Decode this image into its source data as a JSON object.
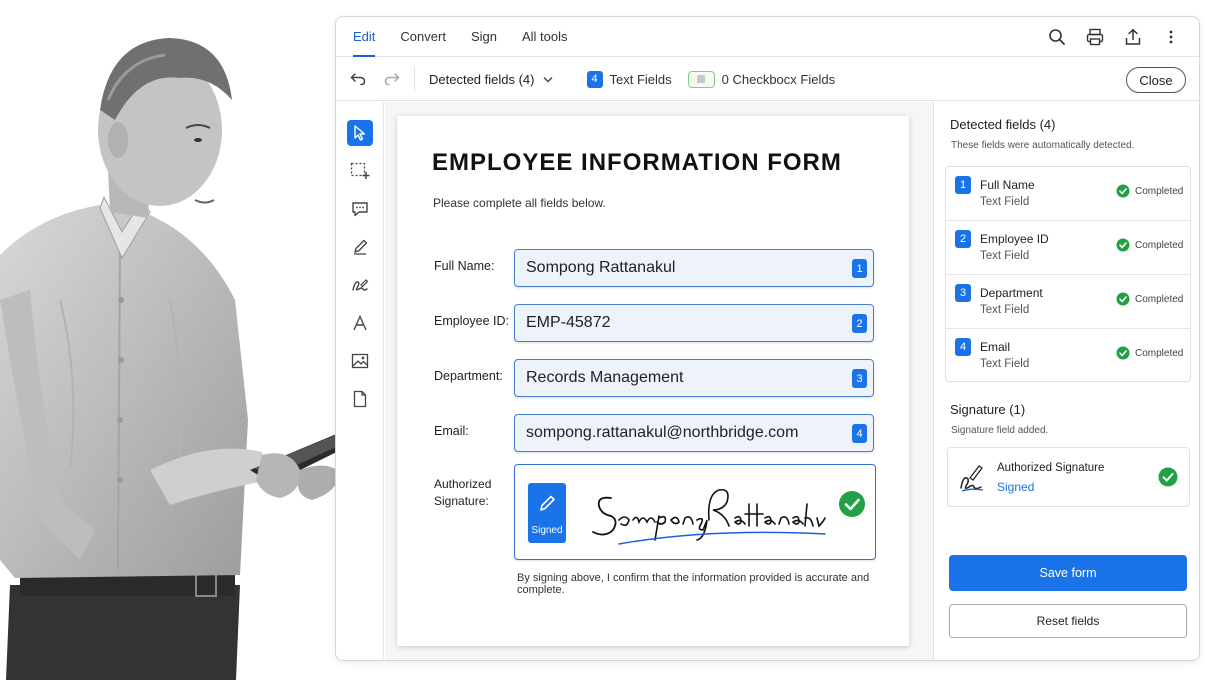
{
  "menubar": {
    "tabs": [
      {
        "label": "Edit",
        "active": true
      },
      {
        "label": "Convert"
      },
      {
        "label": "Sign"
      },
      {
        "label": "All tools"
      }
    ],
    "tools": [
      "search-icon",
      "print-icon",
      "share-icon",
      "more-icon"
    ]
  },
  "toolbar": {
    "detected_label": "Detected fields (4)",
    "text_fields_count": "4",
    "text_fields_label": "Text Fields",
    "checkbox_label": "0  Checkbocx Fields",
    "close_label": "Close"
  },
  "left_tools": [
    "select-pointer-icon",
    "area-select-icon",
    "comment-icon",
    "pen-icon",
    "sign-icon",
    "text-icon",
    "image-icon",
    "page-icon"
  ],
  "form": {
    "title": "EMPLOYEE INFORMATION FORM",
    "subtitle": "Please complete all fields below.",
    "fields": [
      {
        "label": "Full Name:",
        "value": "Sompong Rattanakul",
        "num": "1"
      },
      {
        "label": "Employee ID:",
        "value": "EMP-45872",
        "num": "2"
      },
      {
        "label": "Department:",
        "value": "Records Management",
        "num": "3"
      },
      {
        "label": "Email:",
        "value": "sompong.rattanakul@northbridge.com",
        "num": "4"
      }
    ],
    "signature_label_1": "Authorized",
    "signature_label_2": "Signature:",
    "signed_tag": "Signed",
    "signature_text": "Sompong Rattanakul",
    "confirm": "By signing above, I confirm that the information provided is accurate and complete."
  },
  "panel": {
    "detected_title": "Detected fields (4)",
    "detected_sub": "These fields were automatically detected.",
    "items": [
      {
        "num": "1",
        "name": "Full Name",
        "type": "Text Field",
        "status": "Completed"
      },
      {
        "num": "2",
        "name": "Employee ID",
        "type": "Text Field",
        "status": "Completed"
      },
      {
        "num": "3",
        "name": "Department",
        "type": "Text Field",
        "status": "Completed"
      },
      {
        "num": "4",
        "name": "Email",
        "type": "Text Field",
        "status": "Completed"
      }
    ],
    "signature_title": "Signature (1)",
    "signature_sub": "Signature field added.",
    "signature_name": "Authorized Signature",
    "signature_status": "Signed",
    "save_label": "Save form",
    "reset_label": "Reset fields"
  },
  "colors": {
    "accent": "#1a73e8",
    "success": "#22a045"
  }
}
